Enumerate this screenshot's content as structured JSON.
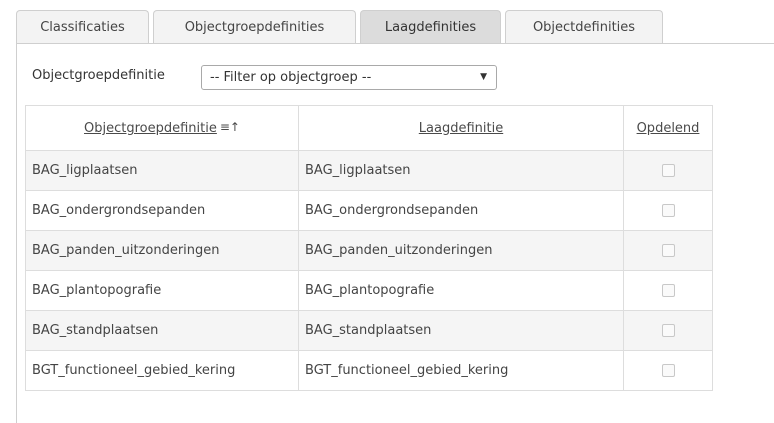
{
  "tabs": [
    {
      "label": "Classificaties",
      "active": false
    },
    {
      "label": "Objectgroepdefinities",
      "active": false
    },
    {
      "label": "Laagdefinities",
      "active": true
    },
    {
      "label": "Objectdefinities",
      "active": false
    }
  ],
  "filter": {
    "label": "Objectgroepdefinitie",
    "selected": "-- Filter op objectgroep --"
  },
  "table": {
    "columns": [
      "Objectgroepdefinitie",
      "Laagdefinitie",
      "Opdelend"
    ],
    "sort_icon": "sort-ascending-icon",
    "rows": [
      {
        "objectgroep": "BAG_ligplaatsen",
        "laag": "BAG_ligplaatsen",
        "opdelend": false
      },
      {
        "objectgroep": "BAG_ondergrondsepanden",
        "laag": "BAG_ondergrondsepanden",
        "opdelend": false
      },
      {
        "objectgroep": "BAG_panden_uitzonderingen",
        "laag": "BAG_panden_uitzonderingen",
        "opdelend": false
      },
      {
        "objectgroep": "BAG_plantopografie",
        "laag": "BAG_plantopografie",
        "opdelend": false
      },
      {
        "objectgroep": "BAG_standplaatsen",
        "laag": "BAG_standplaatsen",
        "opdelend": false
      },
      {
        "objectgroep": "BGT_functioneel_gebied_kering",
        "laag": "BGT_functioneel_gebied_kering",
        "opdelend": false
      }
    ]
  }
}
